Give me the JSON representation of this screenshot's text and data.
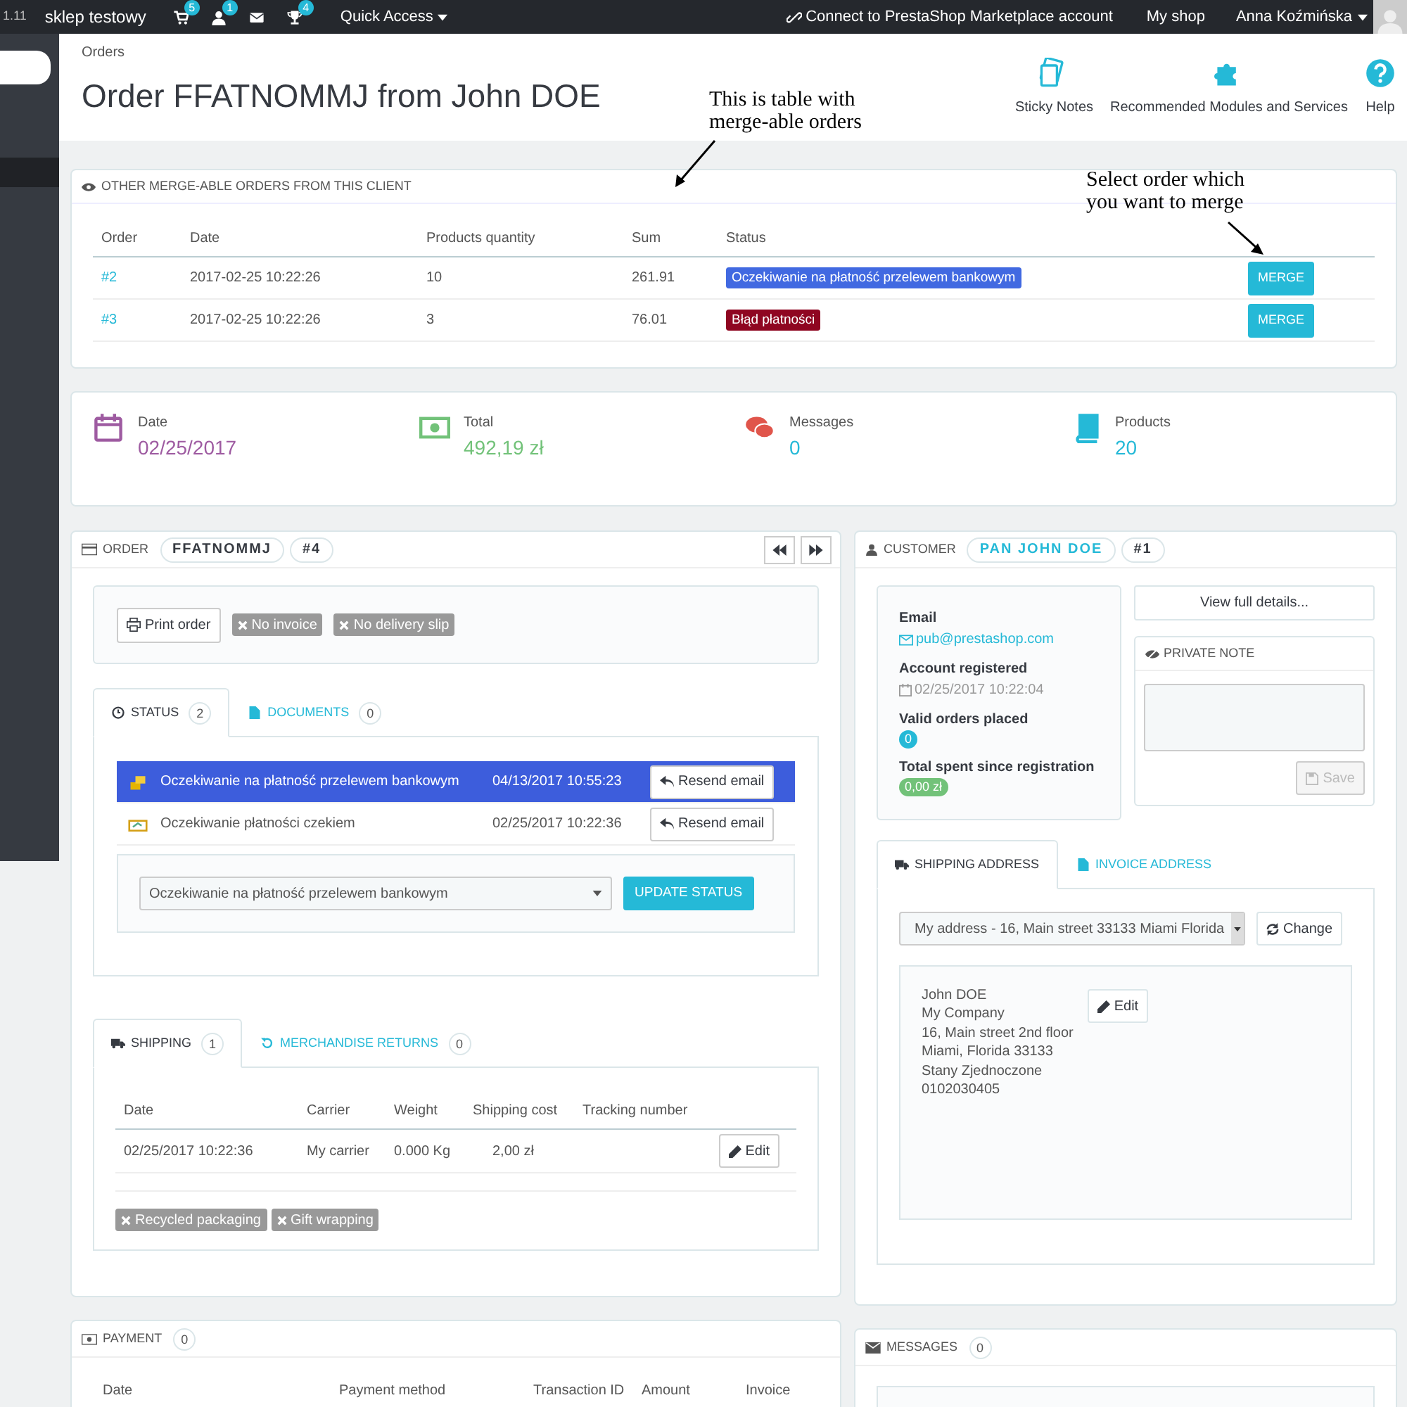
{
  "top_bar": {
    "version": "1.11",
    "shop_name": "sklep testowy",
    "notifications": [
      {
        "kind": "cart",
        "badge": "5"
      },
      {
        "kind": "customer",
        "badge": "1"
      },
      {
        "kind": "mail"
      },
      {
        "kind": "trophy",
        "badge": "4"
      }
    ],
    "quick_access": "Quick Access",
    "marketplace": "Connect to PrestaShop Marketplace account",
    "my_shop": "My shop",
    "user": "Anna Koźmińska"
  },
  "header": {
    "breadcrumb": "Orders",
    "title": "Order FFATNOMMJ from John DOE",
    "toolbar": [
      {
        "kind": "notes",
        "label": "Sticky Notes"
      },
      {
        "kind": "puzzle",
        "label": "Recommended Modules and Services"
      },
      {
        "kind": "help",
        "label": "Help"
      }
    ]
  },
  "annotations": [
    {
      "kind": "table",
      "text": "This is table with\nmerge-able orders"
    },
    {
      "kind": "merge",
      "text": "Select order which\nyou want to merge"
    }
  ],
  "merge_panel": {
    "title": "OTHER MERGE-ABLE ORDERS FROM THIS CLIENT",
    "columns": [
      "Order",
      "Date",
      "Products quantity",
      "Sum",
      "Status"
    ],
    "rows": [
      {
        "order": "#2",
        "date": "2017-02-25 10:22:26",
        "quantity": "10",
        "sum": "261.91",
        "status": "Oczekiwanie na płatność przelewem bankowym",
        "color": "#4169e1",
        "button": "MERGE"
      },
      {
        "order": "#3",
        "date": "2017-02-25 10:22:26",
        "quantity": "3",
        "sum": "76.01",
        "status": "Błąd płatności",
        "color": "#8f0621",
        "button": "MERGE"
      }
    ]
  },
  "kpis": [
    {
      "kind": "date",
      "label": "Date",
      "value": "02/25/2017",
      "color": "#9e5ba1"
    },
    {
      "kind": "total",
      "label": "Total",
      "value": "492,19 zł",
      "color": "#72c279"
    },
    {
      "kind": "messages",
      "label": "Messages",
      "value": "0",
      "color": "#25b9d7"
    },
    {
      "kind": "products",
      "label": "Products",
      "value": "20",
      "color": "#25b9d7"
    }
  ],
  "order_panel": {
    "heading": "ORDER",
    "reference": "FFATNOMMJ",
    "number": "#4",
    "print_button": "Print order",
    "tags": [
      "No invoice",
      "No delivery slip"
    ],
    "tabs": [
      {
        "kind": "status",
        "label": "STATUS",
        "count": "2",
        "selected": true
      },
      {
        "kind": "documents",
        "label": "DOCUMENTS",
        "count": "0",
        "selected": false
      }
    ],
    "history": [
      {
        "kind": "bank",
        "status": "Oczekiwanie na płatność przelewem bankowym",
        "date": "04/13/2017 10:55:23",
        "button": "Resend email",
        "selected": true
      },
      {
        "kind": "cheque",
        "status": "Oczekiwanie płatności czekiem",
        "date": "02/25/2017 10:22:36",
        "button": "Resend email",
        "selected": false
      }
    ],
    "status_select": "Oczekiwanie na płatność przelewem bankowym",
    "update_button": "UPDATE STATUS",
    "shipping_tabs": [
      {
        "kind": "truck",
        "label": "SHIPPING",
        "count": "1",
        "selected": true
      },
      {
        "kind": "returns",
        "label": "MERCHANDISE RETURNS",
        "count": "0",
        "selected": false
      }
    ],
    "shipping_columns": [
      "Date",
      "Carrier",
      "Weight",
      "Shipping cost",
      "Tracking number"
    ],
    "shipping_rows": [
      {
        "date": "02/25/2017 10:22:36",
        "carrier": "My carrier",
        "weight": "0.000 Kg",
        "cost": "2,00 zł",
        "button": "Edit"
      }
    ],
    "shipping_tags": [
      "Recycled packaging",
      "Gift wrapping"
    ]
  },
  "payment_panel": {
    "heading": "PAYMENT",
    "count": "0",
    "columns": [
      "Date",
      "Payment method",
      "Transaction ID",
      "Amount",
      "Invoice"
    ]
  },
  "customer_panel": {
    "heading": "CUSTOMER",
    "name": "PAN JOHN DOE",
    "number": "#1",
    "fields": [
      {
        "kind": "email",
        "label": "Email",
        "value": "pub@prestashop.com"
      },
      {
        "kind": "date",
        "label": "Account registered",
        "value": "02/25/2017 10:22:04"
      },
      {
        "kind": "count",
        "label": "Valid orders placed",
        "value": "0"
      },
      {
        "kind": "money",
        "label": "Total spent since registration",
        "value": "0,00 zł"
      }
    ],
    "details_button": "View full details...",
    "private_note": {
      "title": "PRIVATE NOTE",
      "save": "Save"
    },
    "address_tabs": [
      {
        "kind": "truck",
        "label": "SHIPPING ADDRESS",
        "selected": true
      },
      {
        "kind": "file",
        "label": "INVOICE ADDRESS",
        "selected": false
      }
    ],
    "address_select": "My address - 16, Main street 33133 Miami Florida",
    "change_button": "Change",
    "address_lines": [
      "John DOE",
      "My Company",
      "16, Main street 2nd floor",
      "Miami, Florida 33133",
      "Stany Zjednoczone",
      "0102030405"
    ],
    "edit_button": "Edit"
  },
  "messages_panel": {
    "heading": "MESSAGES",
    "count": "0"
  }
}
